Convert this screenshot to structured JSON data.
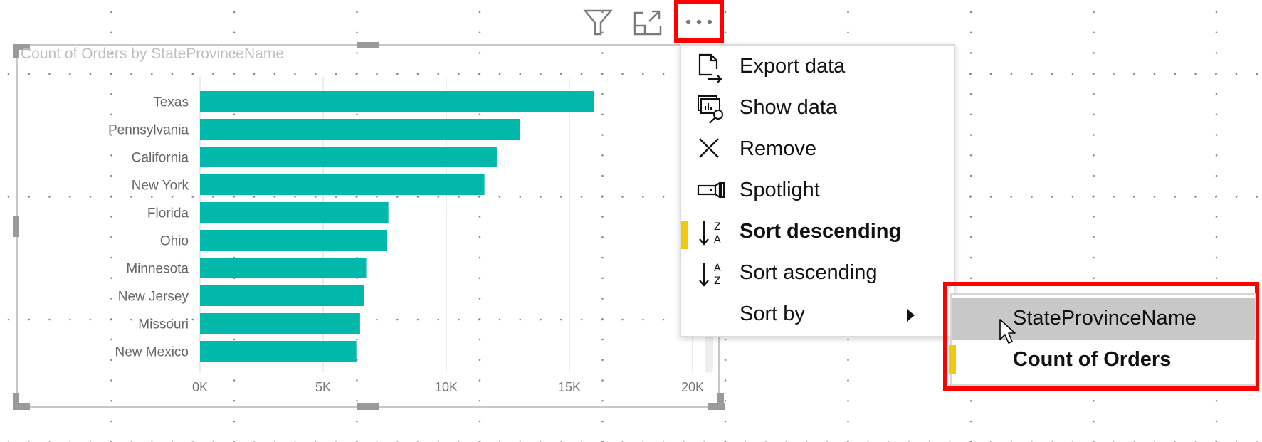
{
  "visual": {
    "title": "Count of Orders by StateProvinceName"
  },
  "header_icons": {
    "filter": "filter-icon",
    "focus_mode": "focus-mode-icon",
    "more_options": "more-options-icon"
  },
  "context_menu": {
    "items": [
      {
        "label": "Export data",
        "icon": "export-data-icon"
      },
      {
        "label": "Show data",
        "icon": "show-data-icon"
      },
      {
        "label": "Remove",
        "icon": "remove-icon"
      },
      {
        "label": "Spotlight",
        "icon": "spotlight-icon"
      },
      {
        "label": "Sort descending",
        "icon": "sort-descending-icon",
        "active": true
      },
      {
        "label": "Sort ascending",
        "icon": "sort-ascending-icon"
      },
      {
        "label": "Sort by",
        "icon": "",
        "has_submenu": true
      }
    ]
  },
  "sort_by_submenu": {
    "items": [
      {
        "label": "StateProvinceName",
        "hovered": true
      },
      {
        "label": "Count of Orders",
        "active": true
      }
    ]
  },
  "colors": {
    "bar": "#01b8aa",
    "highlight_box": "#ff0000",
    "selected_indicator": "#f2c811"
  },
  "chart_data": {
    "type": "bar",
    "orientation": "horizontal",
    "title": "Count of Orders by StateProvinceName",
    "xlabel": "",
    "ylabel": "",
    "categories": [
      "Texas",
      "Pennsylvania",
      "California",
      "New York",
      "Florida",
      "Ohio",
      "Minnesota",
      "New Jersey",
      "Missouri",
      "New Mexico"
    ],
    "series": [
      {
        "name": "Count of Orders",
        "values": [
          16000,
          13000,
          12050,
          11550,
          7650,
          7600,
          6750,
          6650,
          6500,
          6350
        ]
      }
    ],
    "xlim": [
      0,
      20000
    ],
    "x_ticks": [
      0,
      5000,
      10000,
      15000,
      20000
    ],
    "x_tick_labels": [
      "0K",
      "5K",
      "10K",
      "15K",
      "20K"
    ],
    "grid": true,
    "legend": "none"
  }
}
